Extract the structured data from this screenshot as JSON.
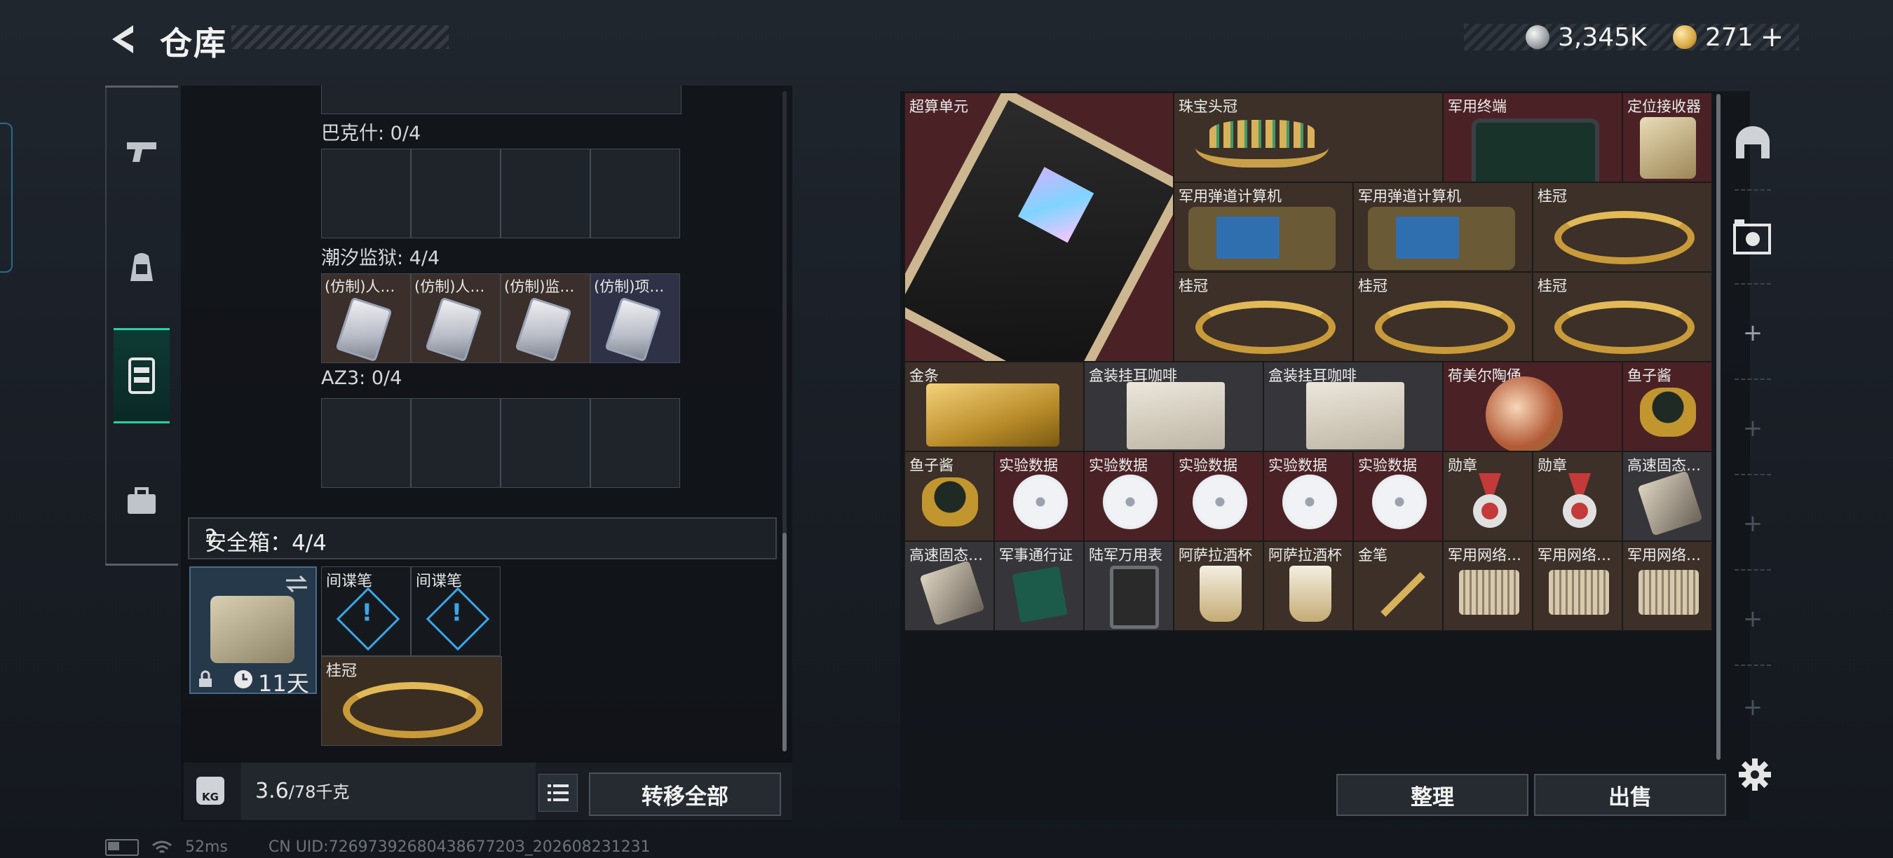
{
  "header": {
    "title": "仓库",
    "currency": [
      {
        "icon": "silver-coin-icon",
        "value": "3,345K"
      },
      {
        "icon": "gold-coin-icon",
        "value": "271"
      }
    ],
    "add_label": "+"
  },
  "left_tabs": [
    {
      "icon": "pistol-icon"
    },
    {
      "icon": "backpack-icon"
    },
    {
      "icon": "vest-icon",
      "active": true
    },
    {
      "icon": "briefcase-icon"
    }
  ],
  "containers": [
    {
      "label": "巴克什: 0/4",
      "slots": [
        "",
        "",
        "",
        ""
      ]
    },
    {
      "label": "潮汐监狱: 4/4",
      "slots": [
        "(仿制)人…",
        "(仿制)人…",
        "(仿制)监…",
        "(仿制)项…"
      ]
    },
    {
      "label": "AZ3: 0/4",
      "slots": [
        "",
        "",
        "",
        ""
      ]
    }
  ],
  "safe": {
    "label": "安全箱：4/4",
    "help": "?",
    "timer": "11天",
    "items": [
      "间谍笔",
      "间谍笔",
      "桂冠"
    ]
  },
  "bottom_left": {
    "weight_value": "3.6",
    "weight_max": "/78千克",
    "kg_label": "KG",
    "transfer_all": "转移全部"
  },
  "stash_items": {
    "row1": [
      "超算单元",
      "珠宝头冠",
      "军用终端",
      "定位接收器"
    ],
    "row2": [
      "军用弹道计算机",
      "军用弹道计算机",
      "桂冠"
    ],
    "row3": [
      "桂冠",
      "桂冠",
      "桂冠"
    ],
    "row4": [
      "金条",
      "盒装挂耳咖啡",
      "盒装挂耳咖啡",
      "荷美尔陶俑",
      "鱼子酱"
    ],
    "row5": [
      "鱼子酱",
      "实验数据",
      "实验数据",
      "实验数据",
      "实验数据",
      "实验数据",
      "勋章",
      "勋章",
      "高速固态…"
    ],
    "row6": [
      "高速固态…",
      "军事通行证",
      "陆军万用表",
      "阿萨拉酒杯",
      "阿萨拉酒杯",
      "金笔",
      "军用网络…",
      "军用网络…",
      "军用网络…"
    ]
  },
  "actions": {
    "sort": "整理",
    "sell": "出售"
  },
  "status": {
    "ping": "52ms",
    "uid": "CN UID:7269739268043867720З_202608231231"
  }
}
